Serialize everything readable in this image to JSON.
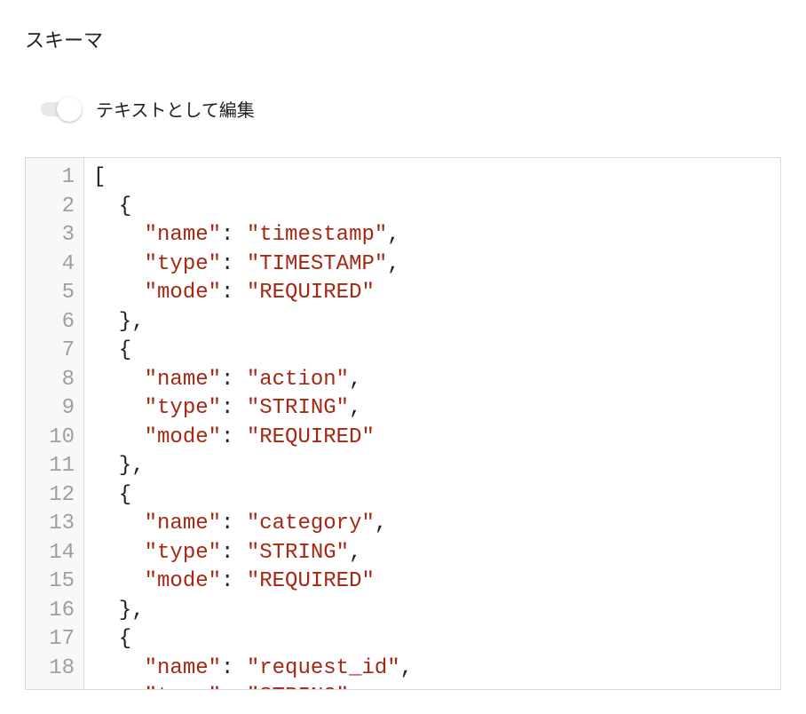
{
  "header": {
    "title": "スキーマ"
  },
  "toggle": {
    "label": "テキストとして編集",
    "state": false
  },
  "editor": {
    "line_numbers": [
      "1",
      "2",
      "3",
      "4",
      "5",
      "6",
      "7",
      "8",
      "9",
      "10",
      "11",
      "12",
      "13",
      "14",
      "15",
      "16",
      "17",
      "18"
    ],
    "lines": [
      [
        {
          "t": "[",
          "c": "punct"
        }
      ],
      [
        {
          "t": "  {",
          "c": "punct"
        }
      ],
      [
        {
          "t": "    ",
          "c": "punct"
        },
        {
          "t": "\"name\"",
          "c": "str"
        },
        {
          "t": ": ",
          "c": "punct"
        },
        {
          "t": "\"timestamp\"",
          "c": "str"
        },
        {
          "t": ",",
          "c": "punct"
        }
      ],
      [
        {
          "t": "    ",
          "c": "punct"
        },
        {
          "t": "\"type\"",
          "c": "str"
        },
        {
          "t": ": ",
          "c": "punct"
        },
        {
          "t": "\"TIMESTAMP\"",
          "c": "str"
        },
        {
          "t": ",",
          "c": "punct"
        }
      ],
      [
        {
          "t": "    ",
          "c": "punct"
        },
        {
          "t": "\"mode\"",
          "c": "str"
        },
        {
          "t": ": ",
          "c": "punct"
        },
        {
          "t": "\"REQUIRED\"",
          "c": "str"
        }
      ],
      [
        {
          "t": "  },",
          "c": "punct"
        }
      ],
      [
        {
          "t": "  {",
          "c": "punct"
        }
      ],
      [
        {
          "t": "    ",
          "c": "punct"
        },
        {
          "t": "\"name\"",
          "c": "str"
        },
        {
          "t": ": ",
          "c": "punct"
        },
        {
          "t": "\"action\"",
          "c": "str"
        },
        {
          "t": ",",
          "c": "punct"
        }
      ],
      [
        {
          "t": "    ",
          "c": "punct"
        },
        {
          "t": "\"type\"",
          "c": "str"
        },
        {
          "t": ": ",
          "c": "punct"
        },
        {
          "t": "\"STRING\"",
          "c": "str"
        },
        {
          "t": ",",
          "c": "punct"
        }
      ],
      [
        {
          "t": "    ",
          "c": "punct"
        },
        {
          "t": "\"mode\"",
          "c": "str"
        },
        {
          "t": ": ",
          "c": "punct"
        },
        {
          "t": "\"REQUIRED\"",
          "c": "str"
        }
      ],
      [
        {
          "t": "  },",
          "c": "punct"
        }
      ],
      [
        {
          "t": "  {",
          "c": "punct"
        }
      ],
      [
        {
          "t": "    ",
          "c": "punct"
        },
        {
          "t": "\"name\"",
          "c": "str"
        },
        {
          "t": ": ",
          "c": "punct"
        },
        {
          "t": "\"category\"",
          "c": "str"
        },
        {
          "t": ",",
          "c": "punct"
        }
      ],
      [
        {
          "t": "    ",
          "c": "punct"
        },
        {
          "t": "\"type\"",
          "c": "str"
        },
        {
          "t": ": ",
          "c": "punct"
        },
        {
          "t": "\"STRING\"",
          "c": "str"
        },
        {
          "t": ",",
          "c": "punct"
        }
      ],
      [
        {
          "t": "    ",
          "c": "punct"
        },
        {
          "t": "\"mode\"",
          "c": "str"
        },
        {
          "t": ": ",
          "c": "punct"
        },
        {
          "t": "\"REQUIRED\"",
          "c": "str"
        }
      ],
      [
        {
          "t": "  },",
          "c": "punct"
        }
      ],
      [
        {
          "t": "  {",
          "c": "punct"
        }
      ],
      [
        {
          "t": "    ",
          "c": "punct"
        },
        {
          "t": "\"name\"",
          "c": "str"
        },
        {
          "t": ": ",
          "c": "punct"
        },
        {
          "t": "\"request_id\"",
          "c": "str"
        },
        {
          "t": ",",
          "c": "punct"
        }
      ]
    ],
    "cutoff_line": [
      {
        "t": "    ",
        "c": "punct"
      },
      {
        "t": "\"type\"",
        "c": "str"
      },
      {
        "t": ": ",
        "c": "punct"
      },
      {
        "t": "\"STRING\"",
        "c": "str"
      },
      {
        "t": ",",
        "c": "punct"
      }
    ]
  }
}
